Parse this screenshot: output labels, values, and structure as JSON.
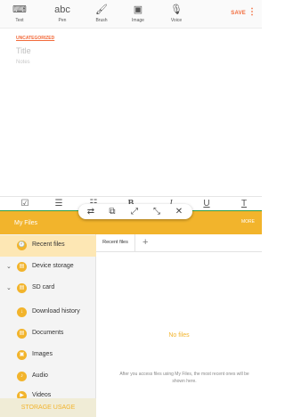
{
  "toolbar": {
    "tools": [
      {
        "label": "Text",
        "icon": "⌨"
      },
      {
        "label": "Pen",
        "icon": "abc"
      },
      {
        "label": "Brush",
        "icon": "🖌"
      },
      {
        "label": "Image",
        "icon": "▣"
      },
      {
        "label": "Voice",
        "icon": "🎙"
      }
    ],
    "save": "SAVE",
    "more_icon": "⋮"
  },
  "note": {
    "category": "UNCATEGORIZED",
    "title_placeholder": "Title",
    "notes_placeholder": "Notes"
  },
  "format_bar": [
    "☑",
    "☰",
    "☷",
    "B",
    "I",
    "U",
    "T"
  ],
  "float_controls": [
    "⇄",
    "⧉",
    "⤢",
    "⤡",
    "✕"
  ],
  "myfiles": {
    "title": "My Files",
    "more": "MORE",
    "nav": [
      {
        "label": "Recent files",
        "icon": "🕘",
        "active": true,
        "expandable": false
      },
      {
        "label": "Device storage",
        "icon": "▤",
        "active": false,
        "expandable": true
      },
      {
        "label": "SD card",
        "icon": "▤",
        "active": false,
        "expandable": true
      },
      {
        "label": "Download history",
        "icon": "↓",
        "active": false,
        "expandable": false
      },
      {
        "label": "Documents",
        "icon": "▤",
        "active": false,
        "expandable": false
      },
      {
        "label": "Images",
        "icon": "▣",
        "active": false,
        "expandable": false
      },
      {
        "label": "Audio",
        "icon": "♪",
        "active": false,
        "expandable": false
      },
      {
        "label": "Videos",
        "icon": "▶",
        "active": false,
        "expandable": false
      }
    ],
    "storage_usage": "STORAGE USAGE",
    "tab": "Recent files",
    "tab_add": "+",
    "empty_title": "No files",
    "empty_hint": "After you access files using My Files, the most recent ones will be shown here."
  },
  "colors": {
    "accent_orange": "#f26a3a",
    "myfiles_yellow": "#f2b42c",
    "active_nav": "#fde7b4"
  }
}
